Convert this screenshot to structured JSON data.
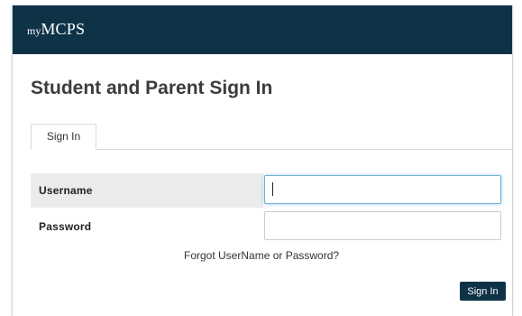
{
  "header": {
    "brand_prefix": "my",
    "brand_name": "MCPS"
  },
  "page": {
    "title": "Student and Parent Sign In"
  },
  "tabs": [
    {
      "label": "Sign In",
      "active": true
    }
  ],
  "form": {
    "username_label": "Username",
    "username_value": "",
    "password_label": "Password",
    "password_value": "",
    "forgot_link": "Forgot UserName or Password?",
    "submit_label": "Sign In"
  },
  "colors": {
    "header_bg": "#0e3347",
    "button_bg": "#0e3347",
    "focus_border": "#6fb0d2",
    "label_row_bg": "#ebebeb"
  }
}
